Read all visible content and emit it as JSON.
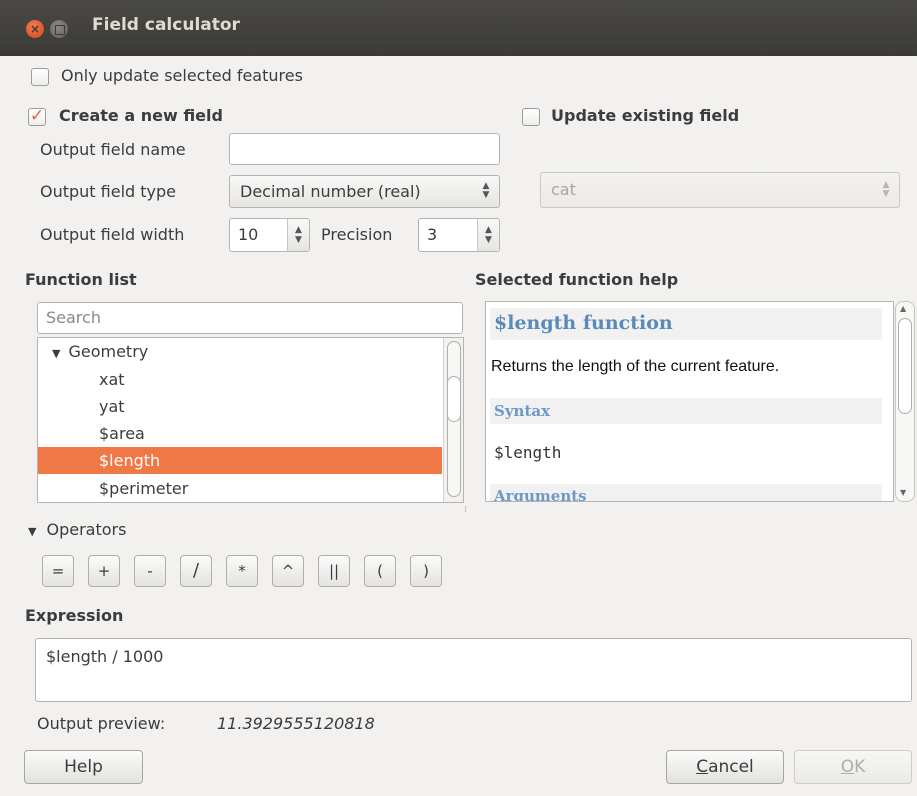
{
  "window": {
    "title": "Field calculator",
    "close_glyph": "×"
  },
  "only_selected": {
    "label": "Only update selected features",
    "checked": false
  },
  "create_field": {
    "label": "Create a new field",
    "checked": true,
    "check_glyph": "✓"
  },
  "update_existing": {
    "label": "Update existing field",
    "checked": false,
    "field_value": "cat"
  },
  "output": {
    "name_label": "Output field name",
    "name_value": "",
    "type_label": "Output field type",
    "type_value": "Decimal number (real)",
    "width_label": "Output field width",
    "width_value": "10",
    "precision_label": "Precision",
    "precision_value": "3"
  },
  "function_list": {
    "heading": "Function list",
    "search_placeholder": "Search",
    "group_arrow": "▼",
    "group": "Geometry",
    "items": [
      "xat",
      "yat",
      "$area",
      "$length",
      "$perimeter"
    ],
    "selected": "$length"
  },
  "help": {
    "heading": "Selected function help",
    "title": "$length function",
    "description": "Returns the length of the current feature.",
    "syntax_heading": "Syntax",
    "syntax": "$length",
    "arguments_heading": "Arguments"
  },
  "operators": {
    "toggle": "▼",
    "label": "Operators",
    "buttons": [
      "=",
      "+",
      "-",
      "/",
      "*",
      "^",
      "||",
      "(",
      ")"
    ]
  },
  "expression": {
    "heading": "Expression",
    "value": "$length / 1000"
  },
  "preview": {
    "label": "Output preview:",
    "value": "11.3929555120818"
  },
  "buttons": {
    "help": "Help",
    "cancel": "Cancel",
    "ok": "OK"
  },
  "colors": {
    "accent": "#f07746",
    "titlebar": "#3c3b37",
    "help_link": "#5a8ab9"
  }
}
